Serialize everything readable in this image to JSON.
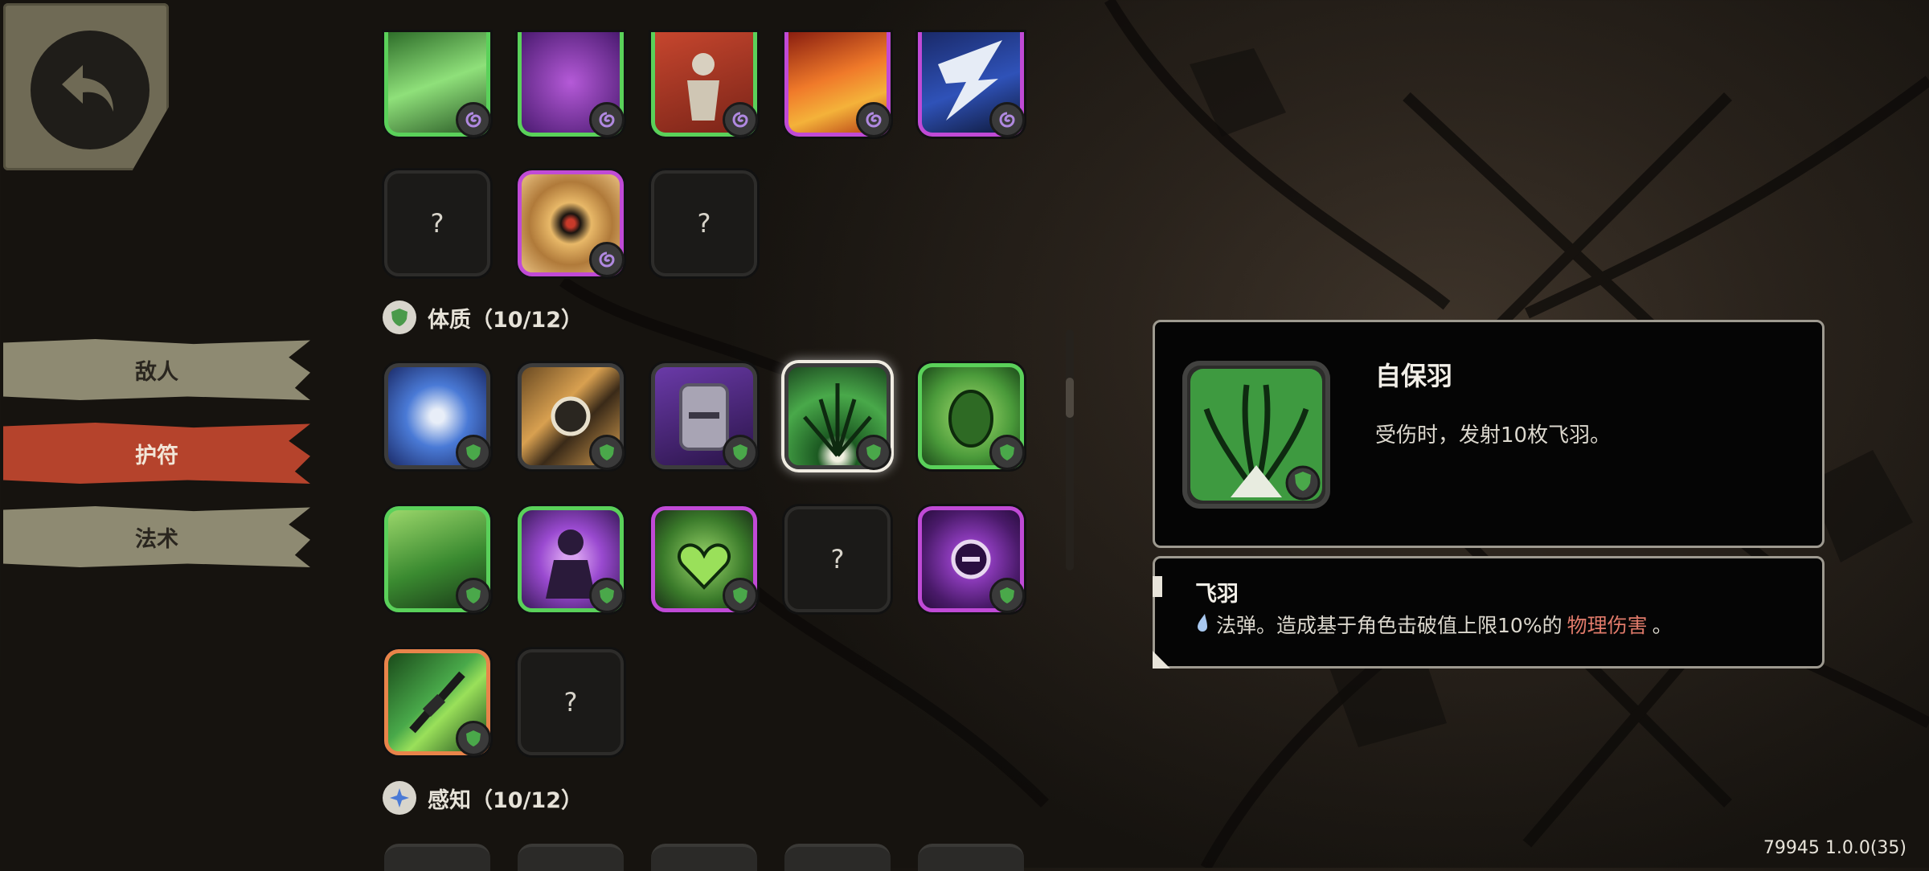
{
  "nav": {
    "back_icon": "back-arrow-icon",
    "tabs": [
      {
        "label": "敌人",
        "active": false
      },
      {
        "label": "护符",
        "active": true
      },
      {
        "label": "法术",
        "active": false
      }
    ]
  },
  "grid": {
    "unknown_label": "?",
    "sections": [
      {
        "title": "体质（10/12）",
        "icon": "shield-icon"
      },
      {
        "title": "感知（10/12）",
        "icon": "sparkle-icon"
      }
    ]
  },
  "detail": {
    "name": "自保羽",
    "description": "受伤时，发射10枚飞羽。",
    "sub_name": "飞羽",
    "sub_desc_prefix": "法弹。造成基于角色击破值上限10%的",
    "sub_desc_highlight": "物理伤害",
    "sub_desc_suffix": "。"
  },
  "version": "79945 1.0.0(35)",
  "colors": {
    "accent_active_tab": "#b5432c",
    "tab_inactive": "#8e8a72",
    "rarity_green": "#5ad15a",
    "rarity_purple": "#c04ad6",
    "rarity_orange": "#e8844a",
    "damage_highlight": "#e07a6a"
  }
}
